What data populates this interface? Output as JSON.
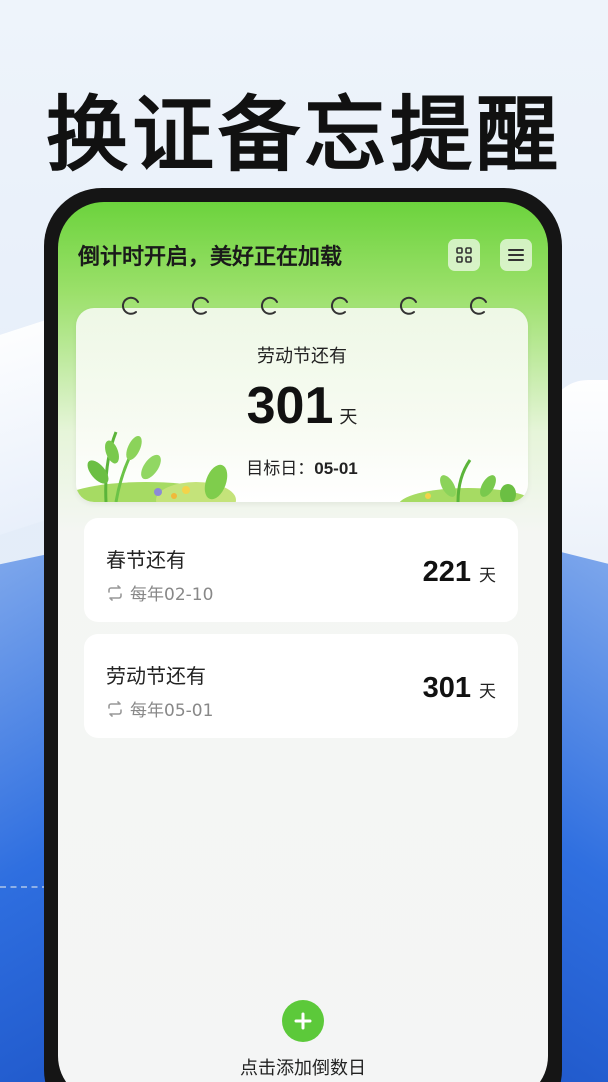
{
  "headline": "换证备忘提醒",
  "app": {
    "slogan": "倒计时开启，美好正在加载",
    "icons": [
      "grid-icon",
      "menu-icon"
    ]
  },
  "hero": {
    "title": "劳动节还有",
    "days": "301",
    "unit": "天",
    "target_label": "目标日：",
    "target_date": "05-01"
  },
  "list": [
    {
      "title": "春节还有",
      "repeat": "每年02-10",
      "days": "221",
      "unit": "天"
    },
    {
      "title": "劳动节还有",
      "repeat": "每年05-01",
      "days": "301",
      "unit": "天"
    }
  ],
  "add": {
    "label": "点击添加倒数日"
  },
  "colors": {
    "accent": "#5cc93a",
    "header_green": "#6cd33d",
    "background_blue": "#2f6fe0"
  }
}
